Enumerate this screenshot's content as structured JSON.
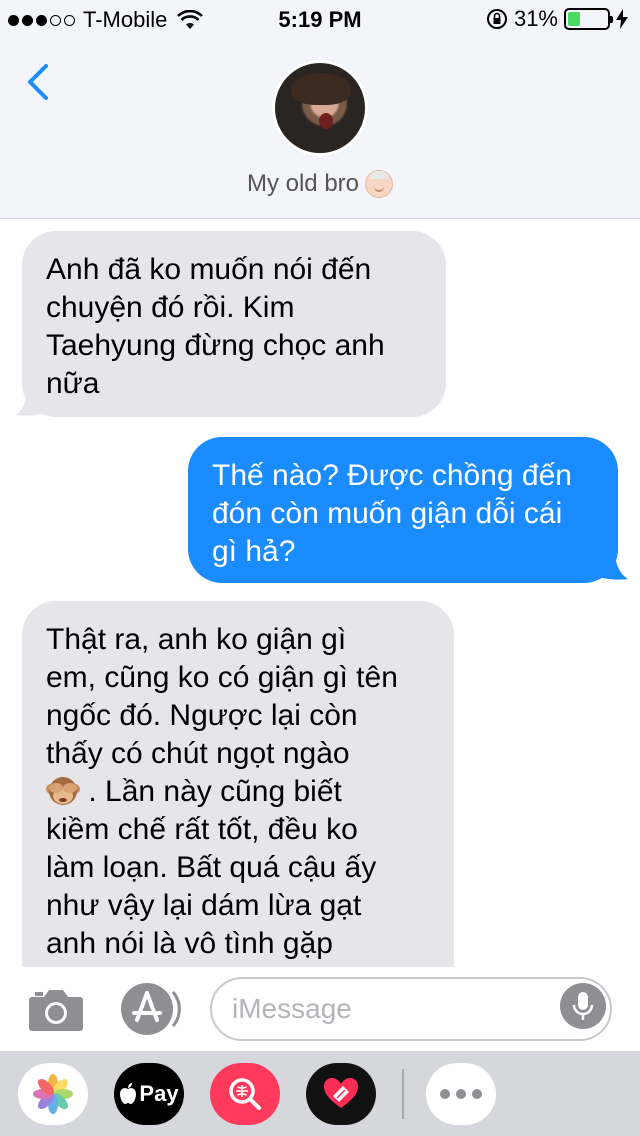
{
  "status_bar": {
    "carrier": "T-Mobile",
    "time": "5:19 PM",
    "battery_percent": "31%",
    "battery_level": 0.31,
    "signal_bars": 3
  },
  "header": {
    "contact_name": "My old bro"
  },
  "messages": [
    {
      "direction": "incoming",
      "text": "Anh đã ko muốn nói đến\nchuyện đó rồi. Kim\nTaehyung đừng chọc anh\nnữa"
    },
    {
      "direction": "outgoing",
      "text": "Thế nào? Được chồng đến\nđón còn muốn giận dỗi cái\ngì hả?"
    },
    {
      "direction": "incoming",
      "text_before_emoji": "Thật ra, anh ko giận gì\nem, cũng ko có giận gì tên\nngốc đó. Ngược lại còn\nthấy có chút ngọt ngào\n",
      "emoji": "see-no-evil-monkey",
      "text_after_emoji": " . Lần này cũng biết\nkiềm chế rất tốt, đều ko\nlàm loạn. Bất quá cậu ấy\nnhư vậy lại dám lừa gạt\nanh nói là vô tình gặp"
    }
  ],
  "input_bar": {
    "placeholder": "iMessage"
  },
  "app_drawer": {
    "apple_pay_label": "Pay",
    "apps": [
      "photos-icon",
      "apple-pay-icon",
      "image-search-icon",
      "heart-app-icon",
      "more-icon"
    ]
  },
  "colors": {
    "incoming_bubble": "#e5e5ea",
    "outgoing_bubble": "#1a8cff",
    "accent": "#1a8cff"
  }
}
